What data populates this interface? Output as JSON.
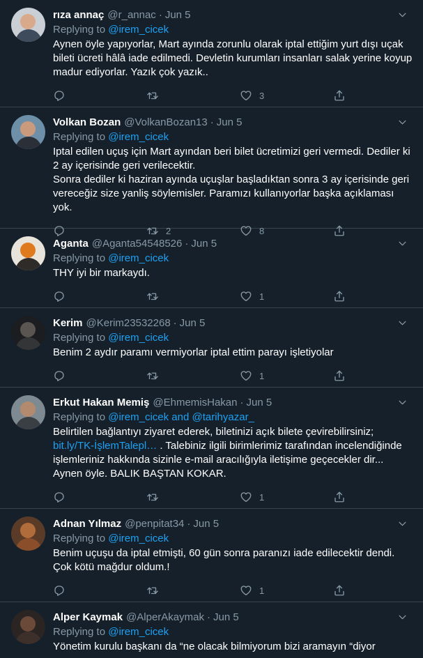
{
  "tweets": [
    {
      "name": "rıza annaç",
      "handle": "@r_annac",
      "time": "Jun 5",
      "replying_prefix": "Replying to ",
      "replying_to": "@irem_cicek",
      "text": "Aynen öyle yapıyorlar,  Mart ayında zorunlu olarak iptal ettiğim yurt dışı uçak bileti ücreti hâlâ iade edilmedi.  Devletin kurumları insanları salak yerine koyup madur ediyorlar. Yazık çok yazık..",
      "replies": "",
      "retweets": "",
      "likes": "3"
    },
    {
      "name": "Volkan Bozan",
      "handle": "@VolkanBozan13",
      "time": "Jun 5",
      "replying_prefix": "Replying to ",
      "replying_to": "@irem_cicek",
      "text": "Iptal edilen uçuş için Mart ayından beri bilet ücretimizi geri vermedi. Dediler ki 2 ay içerisinde geri verilecektir.\nSonra dediler ki haziran ayında uçuşlar başladıktan sonra 3 ay içerisinde geri vereceğiz size yanliş söylemisler. Paramızı kullanıyorlar başka açıklaması yok.",
      "replies": "",
      "retweets": "2",
      "likes": "8"
    },
    {
      "name": "Aganta",
      "handle": "@Aganta54548526",
      "time": "Jun 5",
      "replying_prefix": "Replying to ",
      "replying_to": "@irem_cicek",
      "text": "THY iyi bir markaydı.",
      "replies": "",
      "retweets": "",
      "likes": "1"
    },
    {
      "name": "Kerim",
      "handle": "@Kerim23532268",
      "time": "Jun 5",
      "replying_prefix": "Replying to ",
      "replying_to": "@irem_cicek",
      "text": "Benim 2 aydır paramı vermiyorlar iptal ettim parayı işletiyolar",
      "replies": "",
      "retweets": "",
      "likes": "1"
    },
    {
      "name": "Erkut Hakan Memiş",
      "handle": "@EhmemisHakan",
      "time": "Jun 5",
      "replying_prefix": "Replying to ",
      "replying_to": "@irem_cicek and @tarihyazar_",
      "text_before_link": "Belirtilen bağlantıyı ziyaret ederek, biletinizi açık bilete çevirebilirsiniz; ",
      "link": "bit.ly/TK-İşlemTalepl…",
      "text_after_link": " . Talebiniz ilgili birimlerimiz tarafından incelendiğinde işlemleriniz hakkında sizinle e-mail aracılığıyla iletişime geçecekler dir...\nAynen öyle. BALIK BAŞTAN KOKAR.",
      "replies": "",
      "retweets": "",
      "likes": "1"
    },
    {
      "name": "Adnan Yılmaz",
      "handle": "@penpitat34",
      "time": "Jun 5",
      "replying_prefix": "Replying to ",
      "replying_to": "@irem_cicek",
      "text": "Benim uçuşu da iptal etmişti, 60 gün sonra paranızı iade edilecektir dendi. Çok kötü mağdur oldum.!",
      "replies": "",
      "retweets": "",
      "likes": "1"
    },
    {
      "name": "Alper Kaymak",
      "handle": "@AlperAkaymak",
      "time": "Jun 5",
      "replying_prefix": "Replying to ",
      "replying_to": "@irem_cicek",
      "text": "Yönetim kurulu başkanı da  “ne olacak bilmiyorum bizi aramayın “diyor",
      "replies": "",
      "retweets": "",
      "likes": ""
    }
  ],
  "colors": {
    "background": "#15202b",
    "divider": "#38444d",
    "secondary_text": "#8899a6",
    "accent": "#1da1f2"
  },
  "icons": [
    "reply-icon",
    "retweet-icon",
    "like-icon",
    "share-icon",
    "chevron-down-icon"
  ]
}
